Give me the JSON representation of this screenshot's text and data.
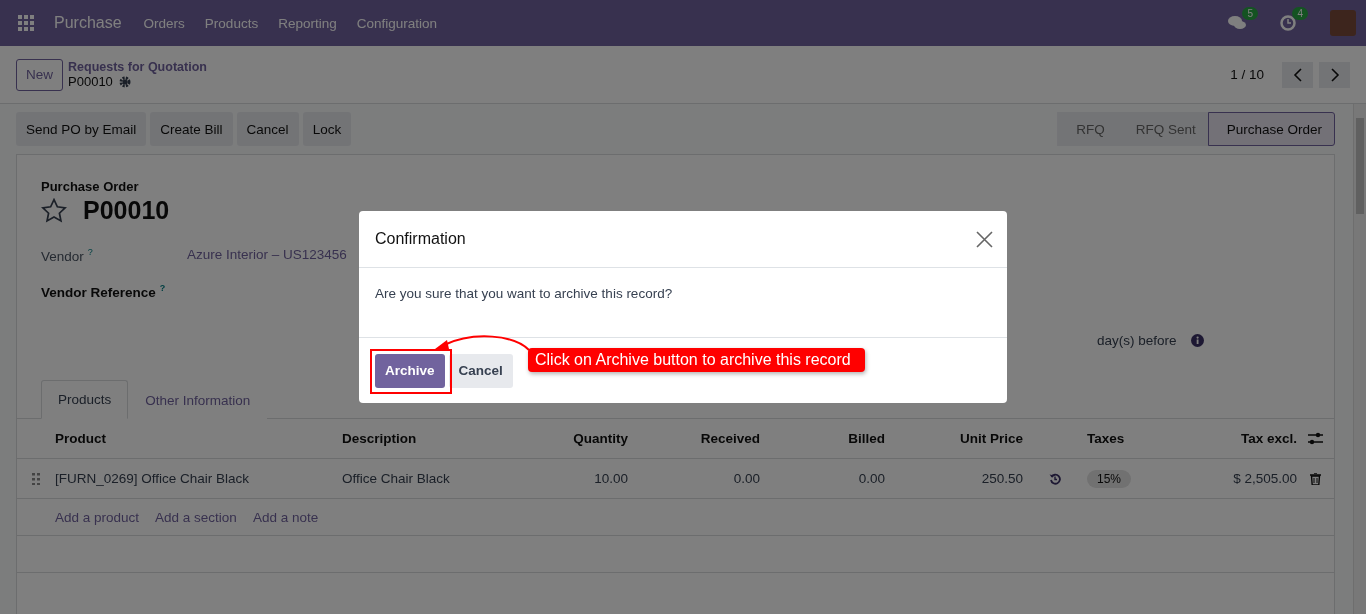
{
  "navbar": {
    "app_name": "Purchase",
    "menu": [
      "Orders",
      "Products",
      "Reporting",
      "Configuration"
    ],
    "messages_count": "5",
    "activities_count": "4"
  },
  "control_panel": {
    "new_button": "New",
    "breadcrumb": "Requests for Quotation",
    "record_name": "P00010",
    "pager": "1 / 10"
  },
  "action_buttons": [
    "Send PO by Email",
    "Create Bill",
    "Cancel",
    "Lock"
  ],
  "statusbar": [
    {
      "label": "RFQ",
      "selected": false
    },
    {
      "label": "RFQ Sent",
      "selected": false
    },
    {
      "label": "Purchase Order",
      "selected": true
    }
  ],
  "form": {
    "title_label": "Purchase Order",
    "name": "P00010",
    "starred": false,
    "fields": [
      {
        "label": "Vendor",
        "help": "?",
        "value": "Azure Interior – US123456",
        "bold": false
      },
      {
        "label": "Vendor Reference",
        "help": "?",
        "bold": true
      }
    ],
    "reminder": "day(s) before"
  },
  "tabs": [
    {
      "label": "Products",
      "selected": true
    },
    {
      "label": "Other Information",
      "selected": false
    }
  ],
  "table": {
    "columns": [
      "Product",
      "Description",
      "Quantity",
      "Received",
      "Billed",
      "Unit Price",
      "Taxes",
      "Tax excl."
    ],
    "rows": [
      {
        "product": "[FURN_0269] Office Chair Black",
        "description": "Office Chair Black",
        "quantity": "10.00",
        "received": "0.00",
        "billed": "0.00",
        "unit_price": "250.50",
        "taxes": "15%",
        "subtotal": "$ 2,505.00"
      }
    ],
    "add_links": [
      "Add a product",
      "Add a section",
      "Add a note"
    ]
  },
  "dialog": {
    "title": "Confirmation",
    "message": "Are you sure that you want to archive this record?",
    "buttons": [
      {
        "label": "Archive",
        "kind": "primary"
      },
      {
        "label": "Cancel",
        "kind": "secondary"
      }
    ]
  },
  "annotation": {
    "text": "Click on Archive button to archive this record"
  }
}
